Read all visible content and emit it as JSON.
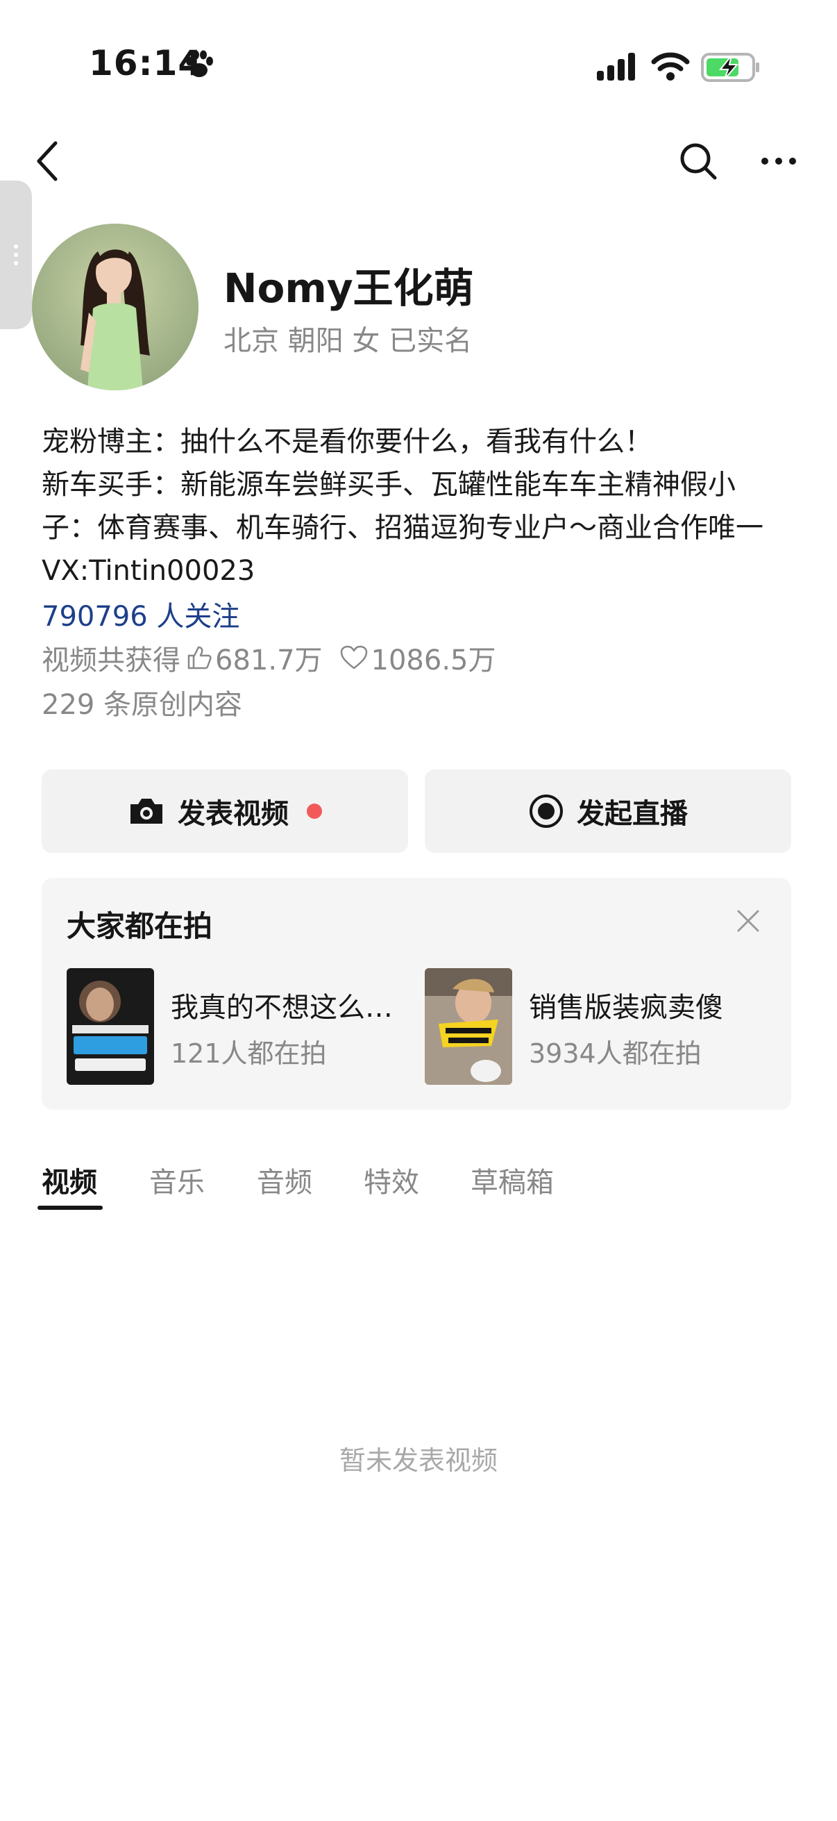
{
  "status_bar": {
    "time": "16:14",
    "icons": [
      "paw-icon",
      "cellular-signal-icon",
      "wifi-icon",
      "battery-charging-icon"
    ],
    "battery_color": "#4cd964"
  },
  "nav": {
    "icons": [
      "back-arrow-icon",
      "search-icon",
      "more-icon"
    ]
  },
  "profile": {
    "name": "Nomy王化萌",
    "meta": "北京 朝阳 女 已实名",
    "bio_lines": [
      "宠粉博主：抽什么不是看你要什么，看我有什么！",
      "新车买手：新能源车尝鲜买手、瓦罐性能车车主精神假小",
      "子：体育赛事、机车骑行、招猫逗狗专业户～商业合作唯一",
      "VX:Tintin00023"
    ],
    "followers": "790796 人关注",
    "stats_prefix": "视频共获得",
    "likes": "681.7万",
    "favorites": "1086.5万",
    "original_count": "229 条原创内容",
    "link_color": "#1d3f8a"
  },
  "actions": {
    "post_video": "发表视频",
    "start_live": "发起直播",
    "badge_color": "#f25a5a"
  },
  "trending": {
    "title": "大家都在拍",
    "items": [
      {
        "title": "我真的不想这么…",
        "count": "121人都在拍"
      },
      {
        "title": "销售版装疯卖傻",
        "count": "3934人都在拍"
      }
    ]
  },
  "tabs": [
    "视频",
    "音乐",
    "音频",
    "特效",
    "草稿箱"
  ],
  "active_tab": "视频",
  "empty_state": "暂未发表视频"
}
